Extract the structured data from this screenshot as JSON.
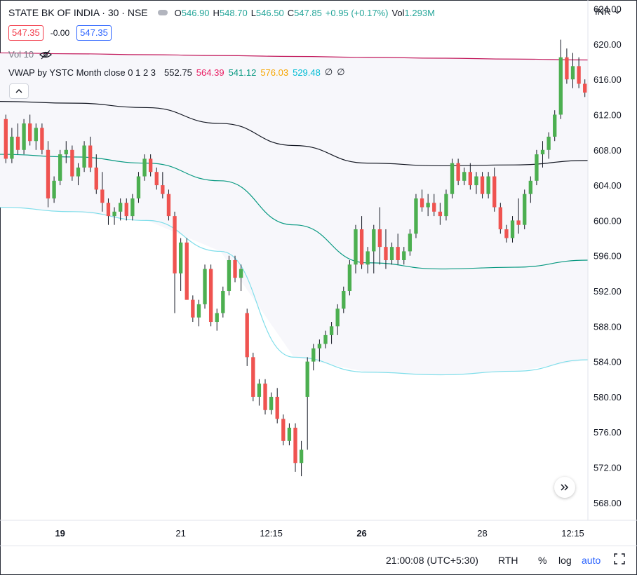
{
  "header": {
    "symbol": "STATE BK OF INDIA · 30 · NSE",
    "ohlc": [
      {
        "key": "O",
        "value": "546.90"
      },
      {
        "key": "H",
        "value": "548.70"
      },
      {
        "key": "L",
        "value": "546.50"
      },
      {
        "key": "C",
        "value": "547.85"
      }
    ],
    "change": "+0.95 (+0.17%)",
    "volume_key": "Vol",
    "volume_value": "1.293M",
    "currency": "INR",
    "bid": "547.35",
    "spread": "-0.00",
    "ask": "547.35",
    "volume_indicator": "Vol 10",
    "vwap_name": "VWAP by YSTC Month close 0 1 2 3",
    "vwap_values": [
      {
        "value": "552.75",
        "color": "#131722"
      },
      {
        "value": "564.39",
        "color": "#e91e63"
      },
      {
        "value": "541.12",
        "color": "#089981"
      },
      {
        "value": "576.03",
        "color": "#f7a600"
      },
      {
        "value": "529.48",
        "color": "#00bcd4"
      },
      {
        "value": "∅",
        "color": "#131722"
      },
      {
        "value": "∅",
        "color": "#131722"
      }
    ]
  },
  "colors": {
    "up": "#4caf50",
    "down": "#ef5350",
    "vwap_upper": "#c2185b",
    "vwap_mid": "#131722",
    "vwap_lower": "#089981",
    "vwap_lower2": "#80deea",
    "band_fill": "#f7f7fb"
  },
  "chart_data": {
    "type": "candlestick",
    "y_axis_labels": [
      "624.00",
      "620.00",
      "616.00",
      "612.00",
      "608.00",
      "604.00",
      "600.00",
      "596.00",
      "592.00",
      "588.00",
      "584.00",
      "580.00",
      "576.00",
      "572.00",
      "568.00"
    ],
    "ylim": [
      566.0,
      625.0
    ],
    "x_axis_labels": [
      {
        "label": "19",
        "bold": true,
        "index": 9
      },
      {
        "label": "21",
        "bold": false,
        "index": 29
      },
      {
        "label": "12:15",
        "bold": false,
        "index": 44
      },
      {
        "label": "26",
        "bold": true,
        "index": 59
      },
      {
        "label": "28",
        "bold": false,
        "index": 79
      },
      {
        "label": "12:15",
        "bold": false,
        "index": 94
      }
    ],
    "candles": [
      [
        611.5,
        612.0,
        606.5,
        607.0
      ],
      [
        607.0,
        610.5,
        606.5,
        609.5
      ],
      [
        609.5,
        611.0,
        607.5,
        608.0
      ],
      [
        608.0,
        611.5,
        607.5,
        611.0
      ],
      [
        611.0,
        612.0,
        608.5,
        609.0
      ],
      [
        609.0,
        611.0,
        608.0,
        610.5
      ],
      [
        610.5,
        611.0,
        607.5,
        608.0
      ],
      [
        608.0,
        609.0,
        601.5,
        602.5
      ],
      [
        602.5,
        605.0,
        602.0,
        604.5
      ],
      [
        604.5,
        608.0,
        604.0,
        607.5
      ],
      [
        607.5,
        609.0,
        606.5,
        608.0
      ],
      [
        608.0,
        608.5,
        604.5,
        605.0
      ],
      [
        605.0,
        606.5,
        604.0,
        606.0
      ],
      [
        606.0,
        609.0,
        605.5,
        608.5
      ],
      [
        608.5,
        609.5,
        605.5,
        606.0
      ],
      [
        606.0,
        607.5,
        603.0,
        603.5
      ],
      [
        603.5,
        605.5,
        601.0,
        602.0
      ],
      [
        602.0,
        602.5,
        599.5,
        600.5
      ],
      [
        600.5,
        601.5,
        599.5,
        601.0
      ],
      [
        601.0,
        602.5,
        600.0,
        602.0
      ],
      [
        602.0,
        602.5,
        600.0,
        600.5
      ],
      [
        600.5,
        603.0,
        600.0,
        602.5
      ],
      [
        602.5,
        605.5,
        602.0,
        605.0
      ],
      [
        605.0,
        607.5,
        604.5,
        607.0
      ],
      [
        607.0,
        607.5,
        605.0,
        605.5
      ],
      [
        605.5,
        606.0,
        603.5,
        604.0
      ],
      [
        604.0,
        605.5,
        602.5,
        603.0
      ],
      [
        603.0,
        603.5,
        600.0,
        600.5
      ],
      [
        600.5,
        601.0,
        589.5,
        594.0
      ],
      [
        594.0,
        598.0,
        592.0,
        597.5
      ],
      [
        597.5,
        598.0,
        591.0,
        591.0
      ],
      [
        591.0,
        591.5,
        588.5,
        589.0
      ],
      [
        589.0,
        591.0,
        588.0,
        590.5
      ],
      [
        590.5,
        595.0,
        590.0,
        594.5
      ],
      [
        594.5,
        595.0,
        588.0,
        588.5
      ],
      [
        588.5,
        590.0,
        587.5,
        589.5
      ],
      [
        589.5,
        592.5,
        589.0,
        592.0
      ],
      [
        592.0,
        596.0,
        591.5,
        595.5
      ],
      [
        595.5,
        596.0,
        593.0,
        593.5
      ],
      [
        593.5,
        595.0,
        592.0,
        594.5
      ],
      [
        589.5,
        590.0,
        583.5,
        584.5
      ],
      [
        584.5,
        585.0,
        579.5,
        580.0
      ],
      [
        580.0,
        582.0,
        579.0,
        581.5
      ],
      [
        581.5,
        582.0,
        578.0,
        578.5
      ],
      [
        578.5,
        580.5,
        578.0,
        580.0
      ],
      [
        580.0,
        581.0,
        577.0,
        577.5
      ],
      [
        577.5,
        578.0,
        574.5,
        575.0
      ],
      [
        575.0,
        577.0,
        574.5,
        576.5
      ],
      [
        576.5,
        577.0,
        571.5,
        572.5
      ],
      [
        572.5,
        575.0,
        571.0,
        574.0
      ],
      [
        580.0,
        584.5,
        574.0,
        584.0
      ],
      [
        584.0,
        586.0,
        583.0,
        585.5
      ],
      [
        585.5,
        586.5,
        584.0,
        586.0
      ],
      [
        586.0,
        587.5,
        585.5,
        587.0
      ],
      [
        587.0,
        588.5,
        586.0,
        588.0
      ],
      [
        588.0,
        590.5,
        587.0,
        590.0
      ],
      [
        590.0,
        592.5,
        589.5,
        592.0
      ],
      [
        592.0,
        595.5,
        591.5,
        595.0
      ],
      [
        595.0,
        599.5,
        594.0,
        599.0
      ],
      [
        599.0,
        600.5,
        594.5,
        595.0
      ],
      [
        595.0,
        597.0,
        594.0,
        596.5
      ],
      [
        596.5,
        599.5,
        594.0,
        599.0
      ],
      [
        599.0,
        601.5,
        595.0,
        597.0
      ],
      [
        597.0,
        599.0,
        594.5,
        595.5
      ],
      [
        595.5,
        597.5,
        595.0,
        597.0
      ],
      [
        597.0,
        598.5,
        595.0,
        595.5
      ],
      [
        595.5,
        597.0,
        595.0,
        596.5
      ],
      [
        596.5,
        599.0,
        596.0,
        598.5
      ],
      [
        598.5,
        603.0,
        598.0,
        602.5
      ],
      [
        602.5,
        603.5,
        601.0,
        601.5
      ],
      [
        601.5,
        603.0,
        600.5,
        602.0
      ],
      [
        602.0,
        603.0,
        600.5,
        601.0
      ],
      [
        601.0,
        602.0,
        599.5,
        600.5
      ],
      [
        600.5,
        603.5,
        600.0,
        603.0
      ],
      [
        603.0,
        607.0,
        602.5,
        606.5
      ],
      [
        606.5,
        607.0,
        604.0,
        604.5
      ],
      [
        604.5,
        606.0,
        604.0,
        605.5
      ],
      [
        605.5,
        606.5,
        603.5,
        604.0
      ],
      [
        604.0,
        605.5,
        603.0,
        605.0
      ],
      [
        605.0,
        605.5,
        602.5,
        603.0
      ],
      [
        603.0,
        605.5,
        602.5,
        605.0
      ],
      [
        605.0,
        606.0,
        601.0,
        601.5
      ],
      [
        601.5,
        602.0,
        598.5,
        599.0
      ],
      [
        599.0,
        599.5,
        597.5,
        598.0
      ],
      [
        598.0,
        600.5,
        597.5,
        600.0
      ],
      [
        600.0,
        602.5,
        598.5,
        599.5
      ],
      [
        599.5,
        603.5,
        599.0,
        603.0
      ],
      [
        603.0,
        605.0,
        602.0,
        604.5
      ],
      [
        604.5,
        608.0,
        604.0,
        607.5
      ],
      [
        607.5,
        609.0,
        606.0,
        608.0
      ],
      [
        608.0,
        610.0,
        607.0,
        609.5
      ],
      [
        609.5,
        612.5,
        609.0,
        612.0
      ],
      [
        612.0,
        620.5,
        611.5,
        618.5
      ],
      [
        618.5,
        619.5,
        615.5,
        616.0
      ],
      [
        616.0,
        619.0,
        615.0,
        617.5
      ],
      [
        617.5,
        618.5,
        615.0,
        615.5
      ],
      [
        615.5,
        616.0,
        614.0,
        614.5
      ]
    ],
    "vwap_upper": [
      619.0,
      618.9,
      618.8,
      618.7,
      618.6,
      618.5,
      618.4,
      618.3,
      618.2
    ],
    "vwap_mid": [
      613.5,
      613.3,
      612.8,
      611.0,
      608.5,
      606.5,
      606.2,
      606.3,
      606.8
    ],
    "vwap_lower": [
      607.5,
      607.2,
      606.5,
      604.5,
      599.5,
      595.2,
      594.5,
      594.7,
      595.5
    ],
    "vwap_lower2": [
      601.5,
      601.0,
      600.0,
      596.5,
      584.5,
      582.8,
      582.5,
      582.9,
      584.2
    ]
  },
  "status": {
    "time": "21:00:08 (UTC+5:30)",
    "rth": "RTH",
    "percent": "%",
    "log": "log",
    "auto": "auto"
  },
  "icons": {
    "currency_caret": "chevron-down-icon",
    "collapse": "chevron-up-icon",
    "scroll": "double-chevron-right-icon",
    "eye": "eye-off-icon",
    "fullscreen": "fullscreen-icon"
  }
}
